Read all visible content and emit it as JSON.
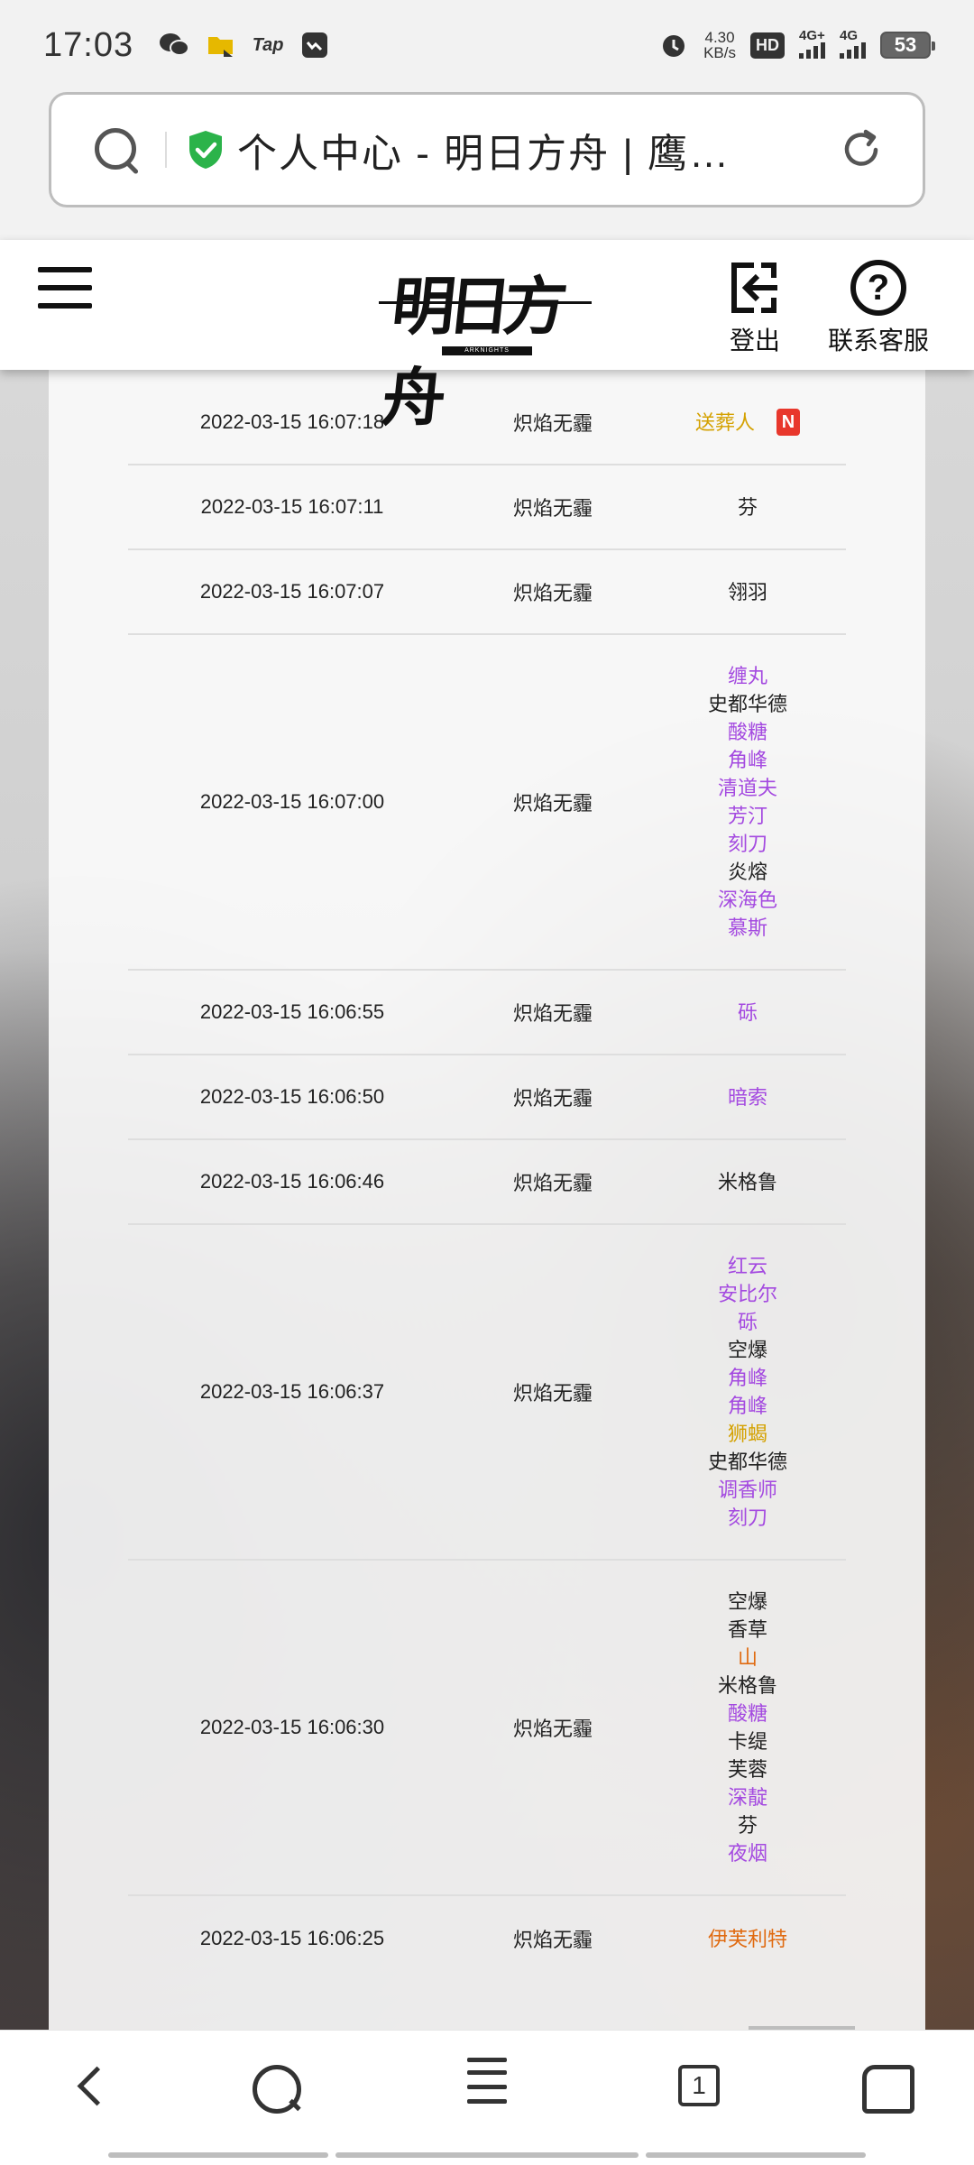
{
  "status_bar": {
    "time": "17:03",
    "app_icons": [
      "wechat-icon",
      "files-icon",
      "tap-icon",
      "message-icon"
    ],
    "tap_label": "Tap",
    "alarm_icon": "alarm-icon",
    "net_speed_value": "4.30",
    "net_speed_unit": "KB/s",
    "hd_label": "HD",
    "signal1_label": "4G+",
    "signal2_label": "4G",
    "battery": "53"
  },
  "address_bar": {
    "title": "个人中心 - 明日方舟 | 鹰…",
    "secure_icon": "shield-check-icon",
    "search_icon": "search-icon",
    "reload_icon": "reload-icon"
  },
  "header": {
    "logo_text": "明日方舟",
    "logo_sub": "ARKNIGHTS",
    "logout_label": "登出",
    "help_label": "联系客服",
    "colors": {
      "accent": "#111111"
    }
  },
  "records": [
    {
      "time": "2022-03-15 16:07:18",
      "pool": "炽焰无霾",
      "ops": [
        {
          "name": "送葬人",
          "rarity": 5,
          "is_new": true,
          "badge": "N"
        }
      ]
    },
    {
      "time": "2022-03-15 16:07:11",
      "pool": "炽焰无霾",
      "ops": [
        {
          "name": "芬",
          "rarity": 3
        }
      ]
    },
    {
      "time": "2022-03-15 16:07:07",
      "pool": "炽焰无霾",
      "ops": [
        {
          "name": "翎羽",
          "rarity": 3
        }
      ]
    },
    {
      "time": "2022-03-15 16:07:00",
      "pool": "炽焰无霾",
      "ops": [
        {
          "name": "缠丸",
          "rarity": 4
        },
        {
          "name": "史都华德",
          "rarity": 3
        },
        {
          "name": "酸糖",
          "rarity": 4
        },
        {
          "name": "角峰",
          "rarity": 4
        },
        {
          "name": "清道夫",
          "rarity": 4
        },
        {
          "name": "芳汀",
          "rarity": 4
        },
        {
          "name": "刻刀",
          "rarity": 4
        },
        {
          "name": "炎熔",
          "rarity": 3
        },
        {
          "name": "深海色",
          "rarity": 4
        },
        {
          "name": "慕斯",
          "rarity": 4
        }
      ]
    },
    {
      "time": "2022-03-15 16:06:55",
      "pool": "炽焰无霾",
      "ops": [
        {
          "name": "砾",
          "rarity": 4
        }
      ]
    },
    {
      "time": "2022-03-15 16:06:50",
      "pool": "炽焰无霾",
      "ops": [
        {
          "name": "暗索",
          "rarity": 4
        }
      ]
    },
    {
      "time": "2022-03-15 16:06:46",
      "pool": "炽焰无霾",
      "ops": [
        {
          "name": "米格鲁",
          "rarity": 3
        }
      ]
    },
    {
      "time": "2022-03-15 16:06:37",
      "pool": "炽焰无霾",
      "ops": [
        {
          "name": "红云",
          "rarity": 4
        },
        {
          "name": "安比尔",
          "rarity": 4
        },
        {
          "name": "砾",
          "rarity": 4
        },
        {
          "name": "空爆",
          "rarity": 3
        },
        {
          "name": "角峰",
          "rarity": 4
        },
        {
          "name": "角峰",
          "rarity": 4
        },
        {
          "name": "狮蝎",
          "rarity": 5
        },
        {
          "name": "史都华德",
          "rarity": 3
        },
        {
          "name": "调香师",
          "rarity": 4
        },
        {
          "name": "刻刀",
          "rarity": 4
        }
      ]
    },
    {
      "time": "2022-03-15 16:06:30",
      "pool": "炽焰无霾",
      "ops": [
        {
          "name": "空爆",
          "rarity": 3
        },
        {
          "name": "香草",
          "rarity": 3
        },
        {
          "name": "山",
          "rarity": 6
        },
        {
          "name": "米格鲁",
          "rarity": 3
        },
        {
          "name": "酸糖",
          "rarity": 4
        },
        {
          "name": "卡缇",
          "rarity": 3
        },
        {
          "name": "芙蓉",
          "rarity": 3
        },
        {
          "name": "深靛",
          "rarity": 4
        },
        {
          "name": "芬",
          "rarity": 3
        },
        {
          "name": "夜烟",
          "rarity": 4
        }
      ]
    },
    {
      "time": "2022-03-15 16:06:25",
      "pool": "炽焰无霾",
      "ops": [
        {
          "name": "伊芙利特",
          "rarity": 6
        }
      ]
    }
  ],
  "rarity_colors": {
    "3": "#222222",
    "4": "#a44ae0",
    "5": "#d4a100",
    "6": "#e06a10"
  },
  "bottom_nav": {
    "items": [
      "back-icon",
      "search-icon",
      "menu-icon",
      "tabs-icon",
      "home-icon"
    ],
    "tab_count": "1"
  }
}
